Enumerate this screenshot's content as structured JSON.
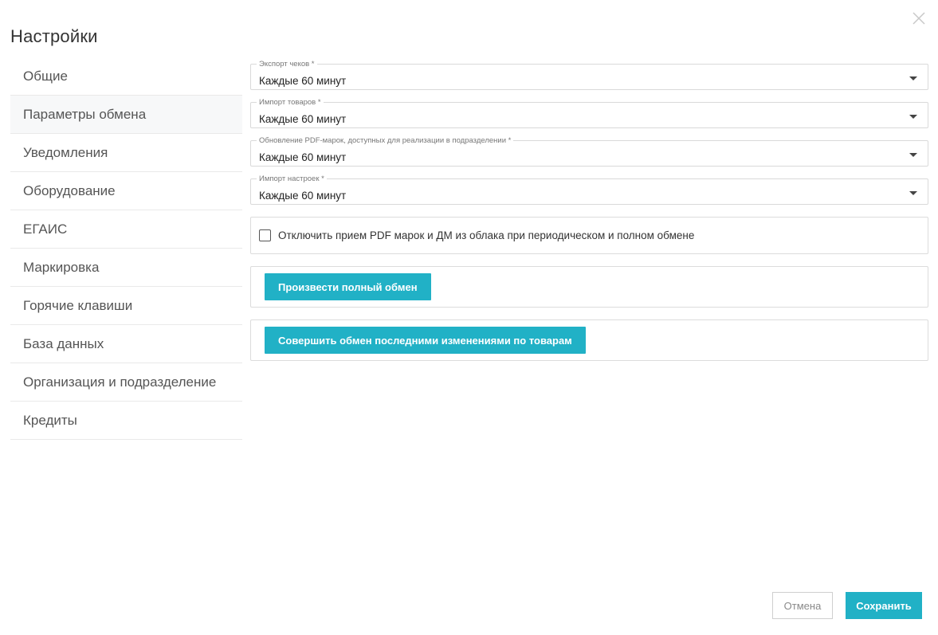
{
  "dialog": {
    "title": "Настройки",
    "close_icon": "close-icon"
  },
  "sidebar": {
    "items": [
      {
        "label": "Общие",
        "active": false
      },
      {
        "label": "Параметры обмена",
        "active": true
      },
      {
        "label": "Уведомления",
        "active": false
      },
      {
        "label": "Оборудование",
        "active": false
      },
      {
        "label": "ЕГАИС",
        "active": false
      },
      {
        "label": "Маркировка",
        "active": false
      },
      {
        "label": "Горячие клавиши",
        "active": false
      },
      {
        "label": "База данных",
        "active": false
      },
      {
        "label": "Организация и подразделение",
        "active": false
      },
      {
        "label": "Кредиты",
        "active": false
      }
    ]
  },
  "exchange": {
    "fields": [
      {
        "label": "Экспорт чеков *",
        "value": "Каждые 60 минут"
      },
      {
        "label": "Импорт товаров *",
        "value": "Каждые 60 минут"
      },
      {
        "label": "Обновление PDF-марок, доступных для реализации в подразделении *",
        "value": "Каждые 60 минут"
      },
      {
        "label": "Импорт настроек *",
        "value": "Каждые 60 минут"
      }
    ],
    "disable_pdf_checkbox": {
      "label": "Отключить прием PDF марок и ДМ из облака при периодическом и полном обмене",
      "checked": false
    },
    "full_exchange_button": "Произвести полный обмен",
    "recent_changes_button": "Совершить обмен последними изменениями по товарам"
  },
  "footer": {
    "cancel_label": "Отмена",
    "save_label": "Сохранить"
  },
  "colors": {
    "accent": "#21b1c6",
    "active_bg": "#f7f8f9",
    "border": "#d9d9d9"
  }
}
